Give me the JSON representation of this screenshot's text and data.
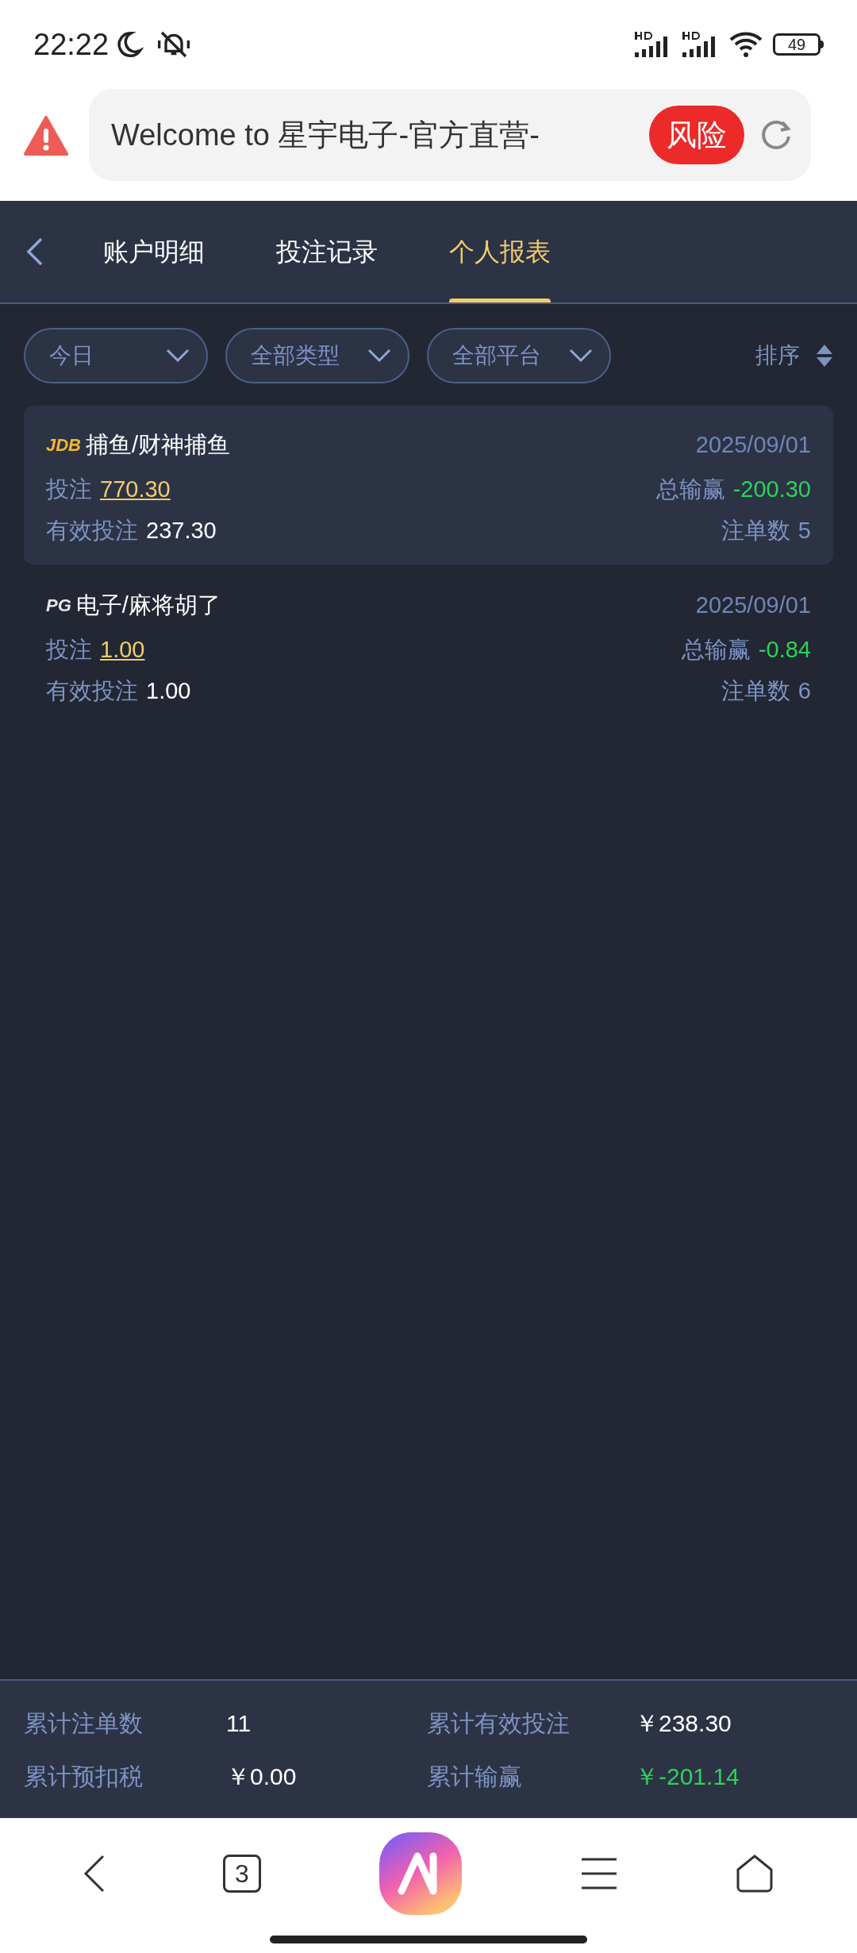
{
  "status_bar": {
    "time": "22:22",
    "battery": "49"
  },
  "address_bar": {
    "title": "Welcome to 星宇电子-官方直营-",
    "risk_badge": "风险"
  },
  "tabs": [
    {
      "label": "账户明细",
      "selected": false
    },
    {
      "label": "投注记录",
      "selected": false
    },
    {
      "label": "个人报表",
      "selected": true
    }
  ],
  "filters": [
    {
      "label": "今日"
    },
    {
      "label": "全部类型"
    },
    {
      "label": "全部平台"
    }
  ],
  "sort": {
    "label": "排序"
  },
  "records": [
    {
      "logo": "JDB",
      "color": "#f5b82e",
      "game": "捕鱼/财神捕鱼",
      "date": "2025/09/01",
      "bet_label": "投注",
      "bet": "770.30",
      "winloss_label": "总输赢",
      "winloss": "-200.30",
      "valid_label": "有效投注",
      "valid": "237.30",
      "count_label": "注单数",
      "count": "5",
      "selected": true
    },
    {
      "logo": "PG",
      "color": "#e5e7eb",
      "game": "电子/麻将胡了",
      "date": "2025/09/01",
      "bet_label": "投注",
      "bet": "1.00",
      "winloss_label": "总输赢",
      "winloss": "-0.84",
      "valid_label": "有效投注",
      "valid": "1.00",
      "count_label": "注单数",
      "count": "6",
      "selected": false
    }
  ],
  "summary": [
    {
      "label": "累计注单数",
      "value": "11",
      "kind": "plain"
    },
    {
      "label": "累计有效投注",
      "value": "￥238.30",
      "kind": "plain"
    },
    {
      "label": "累计预扣税",
      "value": "￥0.00",
      "kind": "plain"
    },
    {
      "label": "累计输赢",
      "value": "￥-201.14",
      "kind": "loss"
    }
  ],
  "bottom_nav": {
    "tab_count": "3"
  }
}
